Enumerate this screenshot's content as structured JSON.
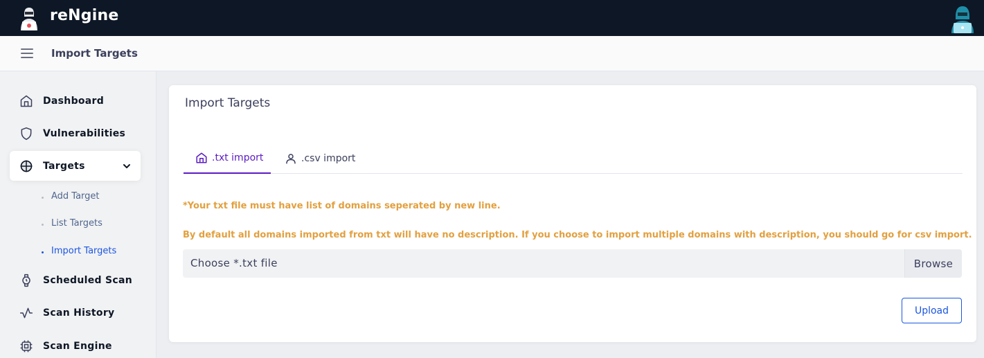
{
  "app": {
    "name": "reNgine"
  },
  "header": {
    "title": "Import Targets"
  },
  "sidebar": {
    "items": [
      {
        "label": "Dashboard"
      },
      {
        "label": "Vulnerabilities"
      },
      {
        "label": "Targets"
      },
      {
        "label": "Scheduled Scan"
      },
      {
        "label": "Scan History"
      },
      {
        "label": "Scan Engine"
      }
    ],
    "targets_submenu": [
      {
        "label": "Add Target"
      },
      {
        "label": "List Targets"
      },
      {
        "label": "Import Targets"
      }
    ],
    "active_item": "Targets",
    "active_subitem": "Import Targets"
  },
  "main": {
    "card_title": "Import Targets",
    "tabs": [
      {
        "label": ".txt import",
        "icon": "home-icon"
      },
      {
        "label": ".csv import",
        "icon": "user-icon"
      }
    ],
    "active_tab": ".txt import",
    "notice_1": "*Your txt file must have list of domains seperated by new line.",
    "notice_2": "By default all domains imported from txt will have no description. If you choose to import multiple domains with description, you should go for csv import.",
    "file_input": {
      "placeholder": "Choose *.txt file",
      "browse_label": "Browse"
    },
    "upload_label": "Upload"
  },
  "colors": {
    "navbar": "#0e1726",
    "accent": "#5c1ac3",
    "primary": "#1b55e2",
    "warning": "#e2a03f"
  }
}
